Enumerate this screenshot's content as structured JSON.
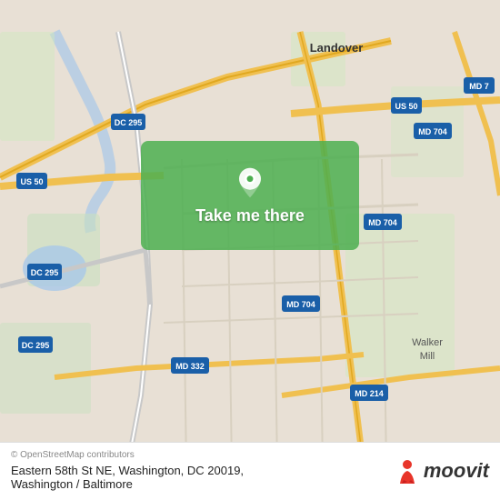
{
  "map": {
    "alt": "Street map of Washington DC area",
    "highlight_color": "#4CAF50"
  },
  "button": {
    "label": "Take me there"
  },
  "bottom_bar": {
    "osm_credit": "© OpenStreetMap contributors",
    "address": "Eastern 58th St NE, Washington, DC 20019,",
    "city": "Washington / Baltimore",
    "logo_text": "moovit"
  },
  "road_labels": [
    {
      "id": "us50_left",
      "text": "US 50"
    },
    {
      "id": "us50_right",
      "text": "US 50"
    },
    {
      "id": "dc295_top",
      "text": "DC 295"
    },
    {
      "id": "dc295_mid",
      "text": "DC 295"
    },
    {
      "id": "dc295_bottom",
      "text": "DC 295"
    },
    {
      "id": "md704_right_top",
      "text": "MD 704"
    },
    {
      "id": "md704_right_mid",
      "text": "MD 704"
    },
    {
      "id": "md704_bottom",
      "text": "MD 704"
    },
    {
      "id": "md332",
      "text": "MD 332"
    },
    {
      "id": "md214",
      "text": "MD 214"
    },
    {
      "id": "md7",
      "text": "MD 7"
    },
    {
      "id": "landover",
      "text": "Landover"
    },
    {
      "id": "walker_mill",
      "text": "Walker\nMill"
    }
  ]
}
